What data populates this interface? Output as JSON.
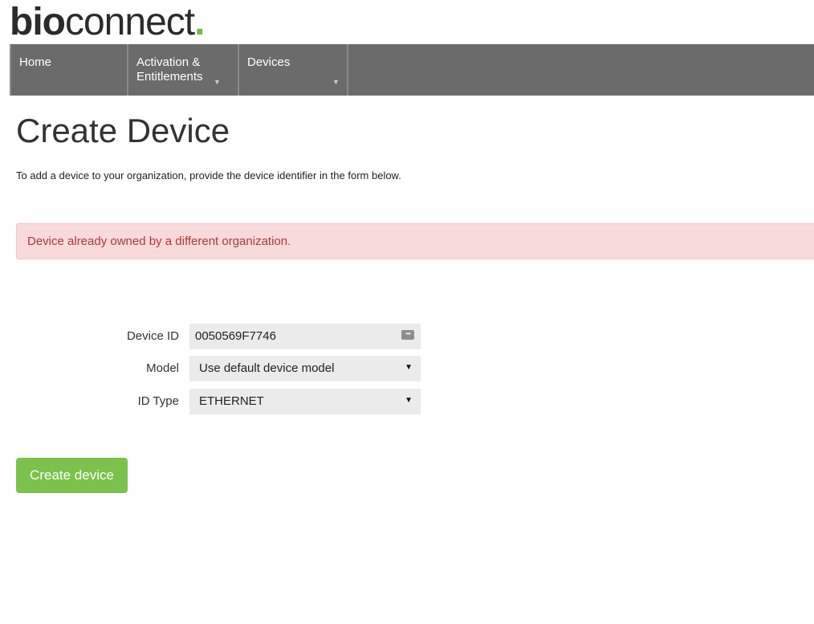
{
  "logo": {
    "part1": "bio",
    "part2": "connect",
    "dot": "."
  },
  "nav": {
    "items": [
      {
        "line1": "Home",
        "line2": ""
      },
      {
        "line1": "Activation &",
        "line2": "Entitlements"
      },
      {
        "line1": "Devices",
        "line2": ""
      }
    ],
    "caret": "▼"
  },
  "page": {
    "title": "Create Device",
    "intro": "To add a device to your organization, provide the device identifier in the form below."
  },
  "alert": {
    "message": "Device already owned by a different organization."
  },
  "form": {
    "device_id": {
      "label": "Device ID",
      "value": "0050569F7746",
      "icon": "keyboard-icon"
    },
    "model": {
      "label": "Model",
      "value": "Use default device model"
    },
    "id_type": {
      "label": "ID Type",
      "value": "ETHERNET"
    },
    "arrow": "▼"
  },
  "actions": {
    "create_label": "Create device"
  },
  "colors": {
    "navbar": "#6b6b6b",
    "brand_green": "#7ab648",
    "button_green": "#7bc14b",
    "alert_bg": "#f9dada",
    "alert_text": "#a83a38"
  }
}
